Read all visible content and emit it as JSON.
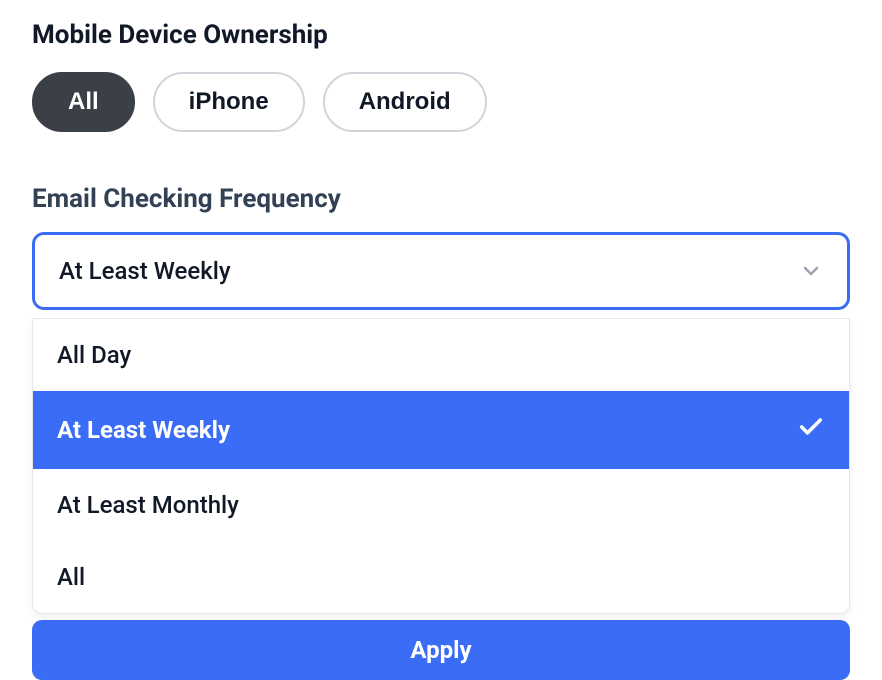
{
  "deviceOwnership": {
    "title": "Mobile Device Ownership",
    "options": [
      {
        "label": "All",
        "selected": true
      },
      {
        "label": "iPhone",
        "selected": false
      },
      {
        "label": "Android",
        "selected": false
      }
    ]
  },
  "emailFrequency": {
    "label": "Email Checking Frequency",
    "selected": "At Least Weekly",
    "options": [
      {
        "label": "All Day",
        "selected": false
      },
      {
        "label": "At Least Weekly",
        "selected": true
      },
      {
        "label": "At Least Monthly",
        "selected": false
      },
      {
        "label": "All",
        "selected": false
      }
    ]
  },
  "applyButton": {
    "label": "Apply"
  }
}
